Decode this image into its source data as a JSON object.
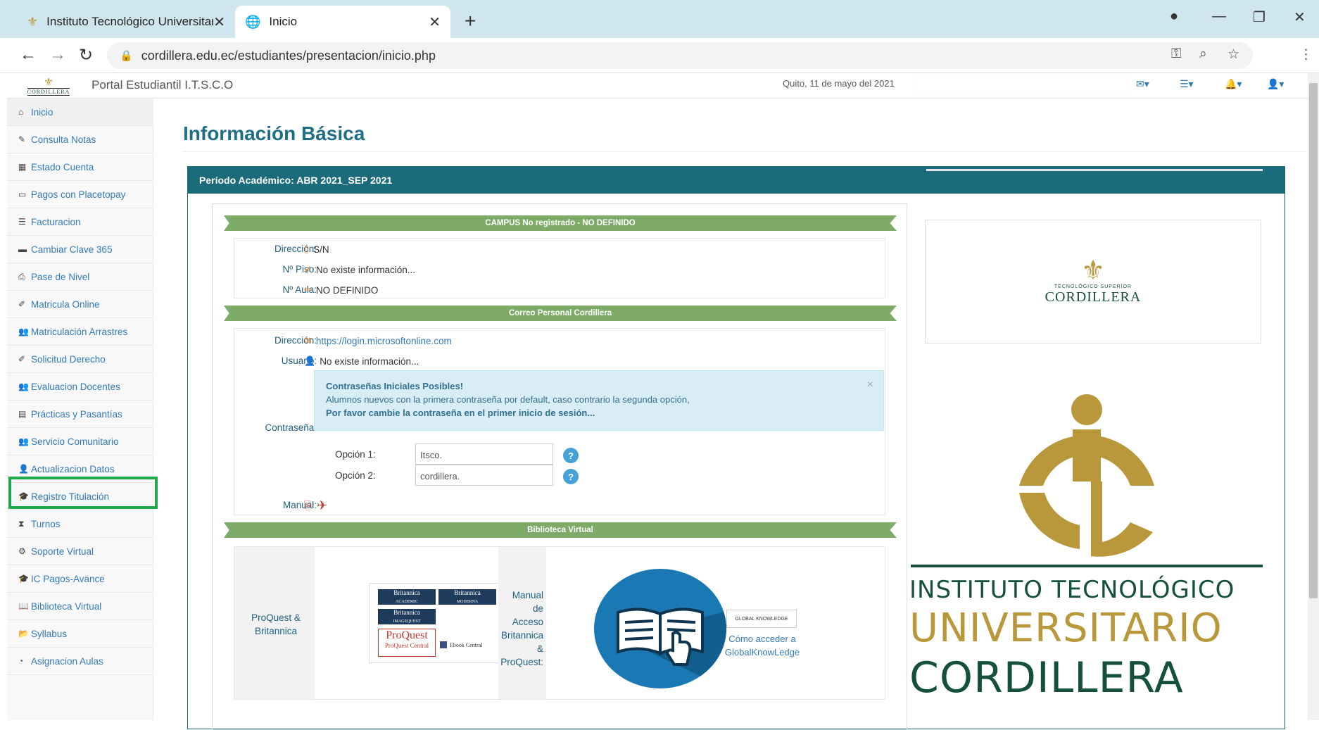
{
  "browser": {
    "tabs": [
      {
        "title": "Instituto Tecnológico Universitari",
        "active": false
      },
      {
        "title": "Inicio",
        "active": true
      }
    ],
    "url": "cordillera.edu.ec/estudiantes/presentacion/inicio.php"
  },
  "header": {
    "brand_word": "CORDILLERA",
    "title": "Portal Estudiantil I.T.S.C.O",
    "date": "Quito, 11 de mayo del 2021"
  },
  "sidebar": {
    "items": [
      {
        "label": "Inicio",
        "icon": "home-icon"
      },
      {
        "label": "Consulta Notas",
        "icon": "pencil-icon"
      },
      {
        "label": "Estado Cuenta",
        "icon": "calculator-icon"
      },
      {
        "label": "Pagos con Placetopay",
        "icon": "credit-card-icon"
      },
      {
        "label": "Facturacion",
        "icon": "list-icon"
      },
      {
        "label": "Cambiar Clave 365",
        "icon": "briefcase-icon"
      },
      {
        "label": "Pase de Nivel",
        "icon": "print-icon"
      },
      {
        "label": "Matricula Online",
        "icon": "edit-icon"
      },
      {
        "label": "Matriculación Arrastres",
        "icon": "users-icon"
      },
      {
        "label": "Solicitud Derecho",
        "icon": "edit-icon"
      },
      {
        "label": "Evaluacion Docentes",
        "icon": "users-icon"
      },
      {
        "label": "Prácticas y Pasantías",
        "icon": "document-icon"
      },
      {
        "label": "Servicio Comunitario",
        "icon": "users-icon"
      },
      {
        "label": "Actualizacion Datos",
        "icon": "user-icon"
      },
      {
        "label": "Registro Titulación",
        "icon": "graduation-cap-icon"
      },
      {
        "label": "Turnos",
        "icon": "hourglass-icon"
      },
      {
        "label": "Soporte Virtual",
        "icon": "cogs-icon"
      },
      {
        "label": "IC Pagos-Avance",
        "icon": "graduation-cap-icon"
      },
      {
        "label": "Biblioteca Virtual",
        "icon": "book-icon"
      },
      {
        "label": "Syllabus",
        "icon": "folder-open-icon"
      },
      {
        "label": "Asignacion Aulas",
        "icon": "dashboard-icon"
      }
    ]
  },
  "main": {
    "title": "Información Básica",
    "panel_heading": "Período Académico: ABR 2021_SEP 2021",
    "campus": {
      "heading": "CAMPUS No registrado - NO DEFINIDO",
      "rows": [
        {
          "label": "Dirección:",
          "value": "S/N"
        },
        {
          "label": "Nº Piso:",
          "value": "No existe información..."
        },
        {
          "label": "Nº Aula:",
          "value": "NO DEFINIDO"
        }
      ]
    },
    "correo": {
      "heading": "Correo Personal Cordillera",
      "direccion_label": "Dirección:",
      "direccion_value": "https://login.microsoftonline.com",
      "usuario_label": "Usuario:",
      "usuario_value": "No existe información...",
      "password_label": "Contraseña:",
      "alert_title": "Contraseñas Iniciales Posibles!",
      "alert_line1": "Alumnos nuevos con la primera contraseña por default, caso contrario la segunda opción,",
      "alert_line2": "Por favor cambie la contraseña en el primer inicio de sesión...",
      "alert_close": "×",
      "option1_label": "Opción 1:",
      "option1_value": "Itsco.",
      "option2_label": "Opción 2:",
      "option2_value": "cordillera.",
      "help_glyph": "?",
      "manual_label": "Manual:"
    },
    "biblioteca": {
      "heading": "Biblioteca Virtual",
      "left_label": "ProQuest & Britannica",
      "logos": {
        "britannica": "Britannica",
        "academic": "ACADEMIC",
        "moderna": "MODERNA",
        "imagequest": "IMAGEQUEST",
        "proquest": "ProQuest",
        "proquest_central": "ProQuest Central",
        "ebook_central": "Ebook Central"
      },
      "manual_label": "Manual de Acceso Britannica & ProQuest:",
      "gk_logo": "GLOBAL KNOWLEDGE",
      "gk_link": "Cómo acceder a GlobalKnowLedge"
    }
  },
  "right": {
    "small_logo_sub": "TECNOLÓGICO SUPERIOR",
    "small_logo_word": "CORDILLERA",
    "big_logo_line1": "INSTITUTO TECNOLÓGICO",
    "big_logo_line2": "UNIVERSITARIO",
    "big_logo_line3": "CORDILLERA"
  },
  "colors": {
    "teal": "#1b6b7a",
    "ribbon_green": "#7eab67",
    "gold": "#b9973b",
    "dark_green": "#15503d",
    "highlight": "#1fa94b"
  }
}
